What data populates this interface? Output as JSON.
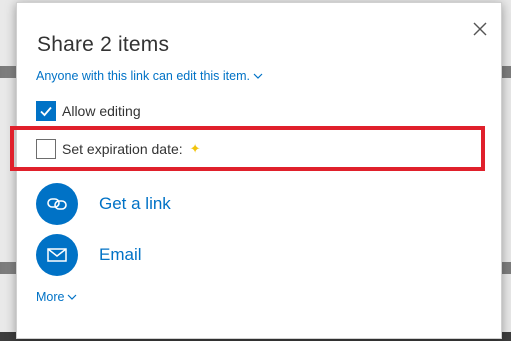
{
  "dialog": {
    "title": "Share 2 items",
    "permission_text": "Anyone with this link can edit this item.",
    "allow_editing": {
      "label": "Allow editing",
      "checked": true
    },
    "expiration": {
      "label": "Set expiration date:",
      "checked": false,
      "badge_icon": "sparkle-icon"
    },
    "actions": [
      {
        "label": "Get a link",
        "icon": "link-icon"
      },
      {
        "label": "Email",
        "icon": "mail-icon"
      }
    ],
    "more_label": "More"
  },
  "colors": {
    "accent": "#0072c6",
    "highlight": "#e0202b",
    "sparkle": "#f2c40c"
  }
}
